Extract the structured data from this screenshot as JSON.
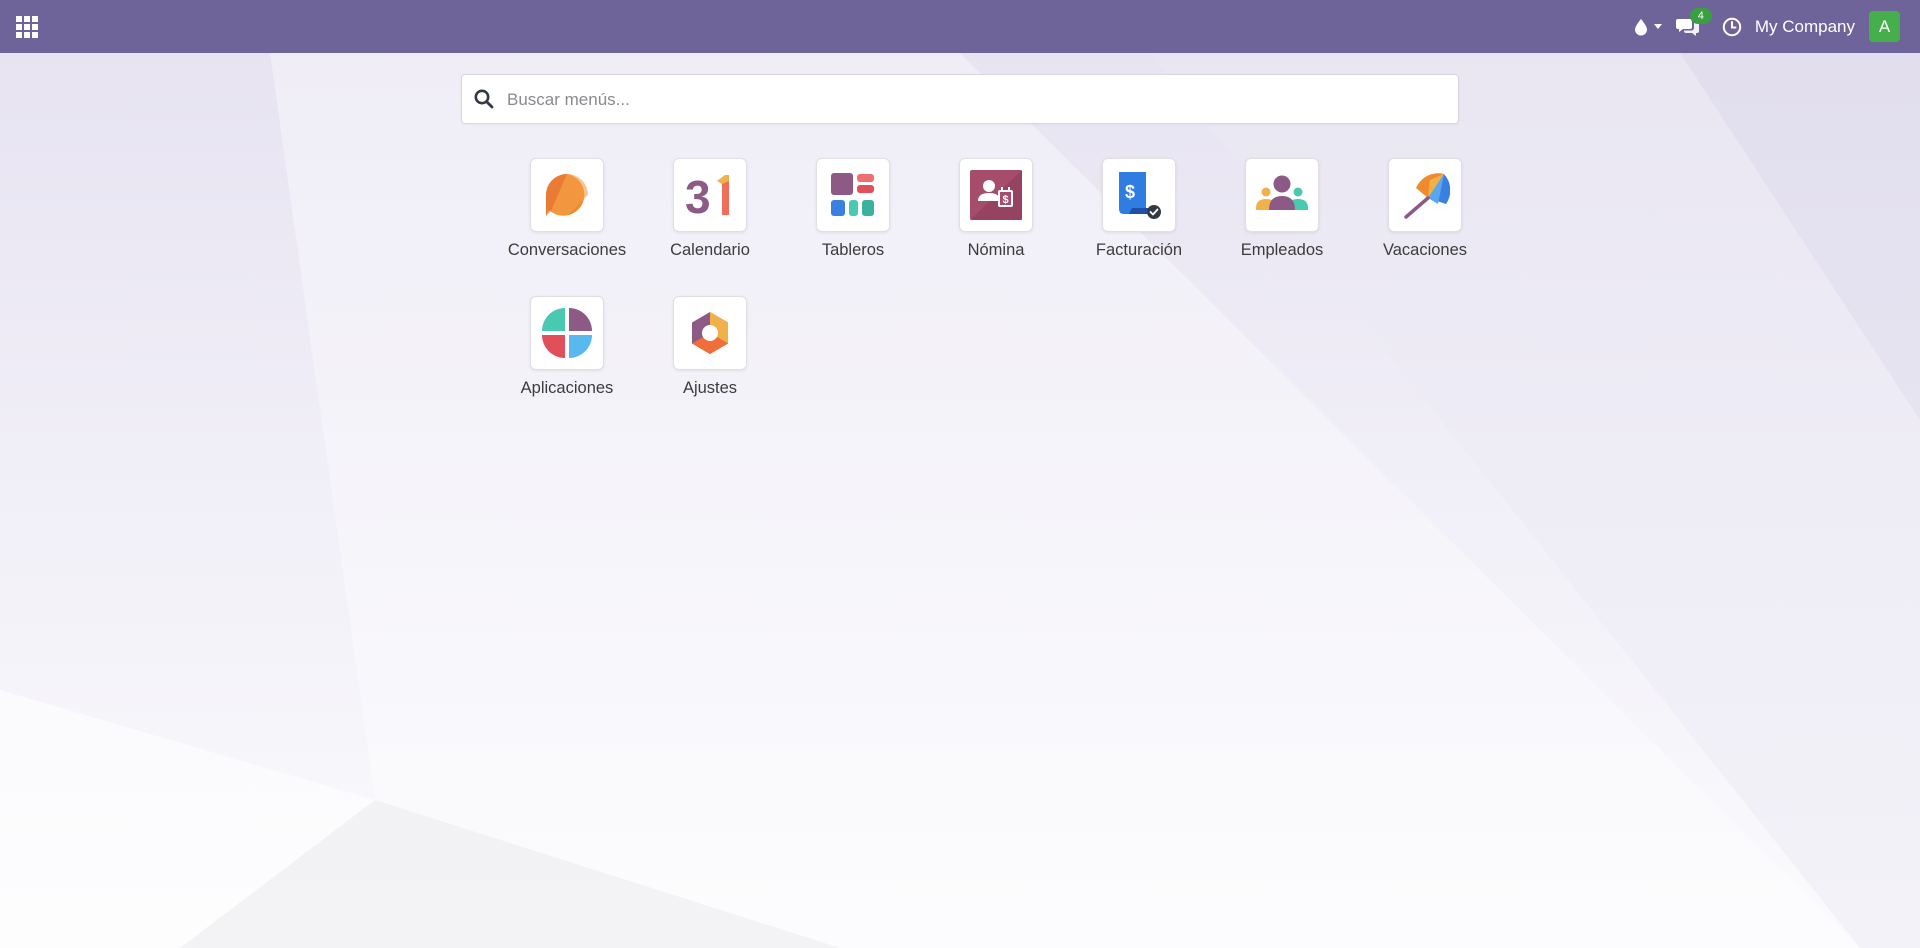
{
  "topbar": {
    "menu_icon": "grid-icon",
    "activity_icon": "droplet-icon",
    "messages_icon": "chat-icon",
    "messages_count": "4",
    "clock_icon": "clock-icon",
    "company_name": "My Company",
    "avatar_letter": "A",
    "colors": {
      "bar": "#6e649a",
      "badge": "#3a9f3e",
      "avatar": "#45b04b"
    }
  },
  "search": {
    "icon": "search-icon",
    "placeholder": "Buscar menús...",
    "value": ""
  },
  "apps": [
    {
      "label": "Conversaciones",
      "icon": "discuss-icon"
    },
    {
      "label": "Calendario",
      "icon": "calendar-icon"
    },
    {
      "label": "Tableros",
      "icon": "dashboards-icon"
    },
    {
      "label": "Nómina",
      "icon": "payroll-icon"
    },
    {
      "label": "Facturación",
      "icon": "invoicing-icon"
    },
    {
      "label": "Empleados",
      "icon": "employees-icon"
    },
    {
      "label": "Vacaciones",
      "icon": "time-off-icon"
    },
    {
      "label": "Aplicaciones",
      "icon": "apps-icon"
    },
    {
      "label": "Ajustes",
      "icon": "settings-icon"
    }
  ]
}
